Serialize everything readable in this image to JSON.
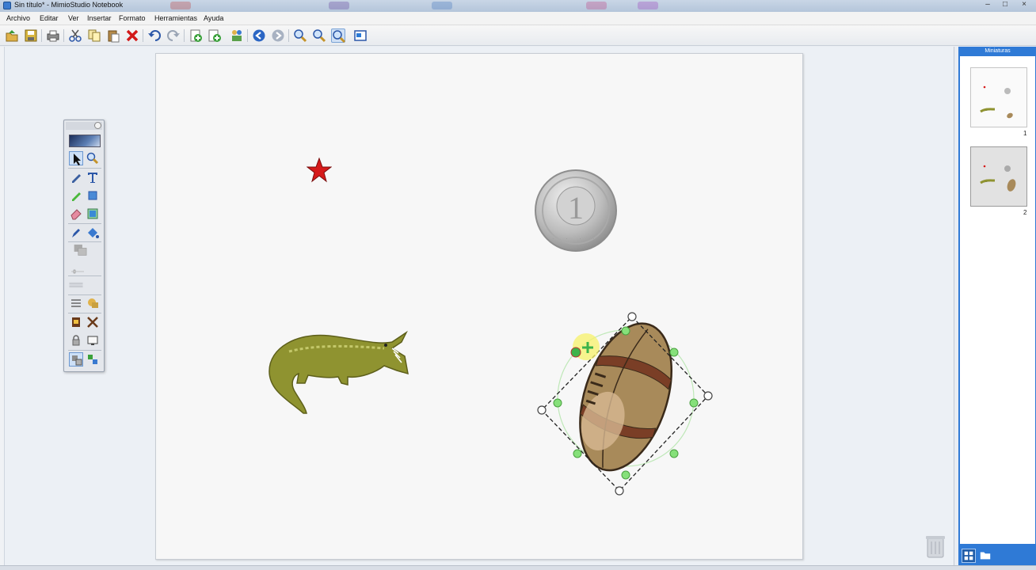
{
  "window": {
    "title": "Sin título* - MimioStudio Notebook",
    "controls": [
      "minimize-icon",
      "maximize-icon",
      "close-icon"
    ]
  },
  "menu": [
    "Archivo",
    "Editar",
    "Ver",
    "Insertar",
    "Formato",
    "Herramientas",
    "Ayuda"
  ],
  "toolbar": {
    "buttons": [
      "open-icon",
      "save-icon",
      "print-icon",
      "cut-icon",
      "copy-icon",
      "paste-icon",
      "delete-icon",
      "undo-icon",
      "redo-icon",
      "new-page-icon",
      "insert-page-icon",
      "gallery-icon",
      "back-icon",
      "forward-icon",
      "zoom-in-icon",
      "zoom-out-icon",
      "zoom-fit-icon",
      "fullscreen-icon"
    ],
    "active": "zoom-fit-icon"
  },
  "tools_panel": {
    "items": [
      "select-arrow-icon",
      "zoom-tool-icon",
      "pen-icon",
      "text-icon",
      "highlighter-icon",
      "shape-icon",
      "eraser-icon",
      "image-tool-icon",
      "eyedropper-icon",
      "fill-icon",
      "color-swatch",
      "transparency-slider",
      "line-style",
      "align-icon",
      "note-icon",
      "reveal-icon",
      "spotlight-icon",
      "lock-icon",
      "screen-icon",
      "group-icon",
      "ungroup-icon"
    ],
    "active": "select-arrow-icon"
  },
  "canvas": {
    "objects": [
      "star",
      "coin",
      "crocodile",
      "football"
    ],
    "selected": "football",
    "coin_label": "1"
  },
  "thumbnails": {
    "header": "Miniaturas",
    "pages": [
      {
        "number": "1",
        "selected": false
      },
      {
        "number": "2",
        "selected": true
      }
    ]
  },
  "colors": {
    "accent": "#2f7ad6",
    "star": "#d61a1a",
    "crocodile": "#8a8e2c",
    "selection_handle": "#86e07a"
  }
}
